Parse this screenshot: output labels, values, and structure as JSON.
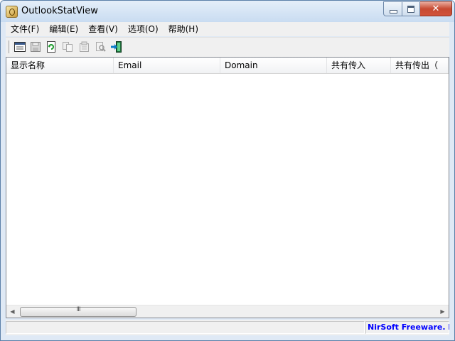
{
  "window": {
    "title": "OutlookStatView",
    "close_glyph": "✕"
  },
  "menu": [
    {
      "label": "文件(F)"
    },
    {
      "label": "编辑(E)"
    },
    {
      "label": "查看(V)"
    },
    {
      "label": "选项(O)"
    },
    {
      "label": "帮助(H)"
    }
  ],
  "toolbar": {
    "icons": [
      "html-report-icon",
      "save-icon",
      "refresh-icon",
      "copy-icon",
      "properties-icon",
      "find-icon",
      "exit-icon"
    ]
  },
  "table": {
    "columns": [
      {
        "label": "显示名称"
      },
      {
        "label": "Email"
      },
      {
        "label": "Domain"
      },
      {
        "label": "共有传入"
      },
      {
        "label": "共有传出（"
      }
    ],
    "rows": []
  },
  "scrollbar": {
    "left_arrow": "◀",
    "right_arrow": "▶",
    "grip": "III"
  },
  "statusbar": {
    "link_text": "NirSoft Freeware.  http://www.nirsoft.net"
  }
}
